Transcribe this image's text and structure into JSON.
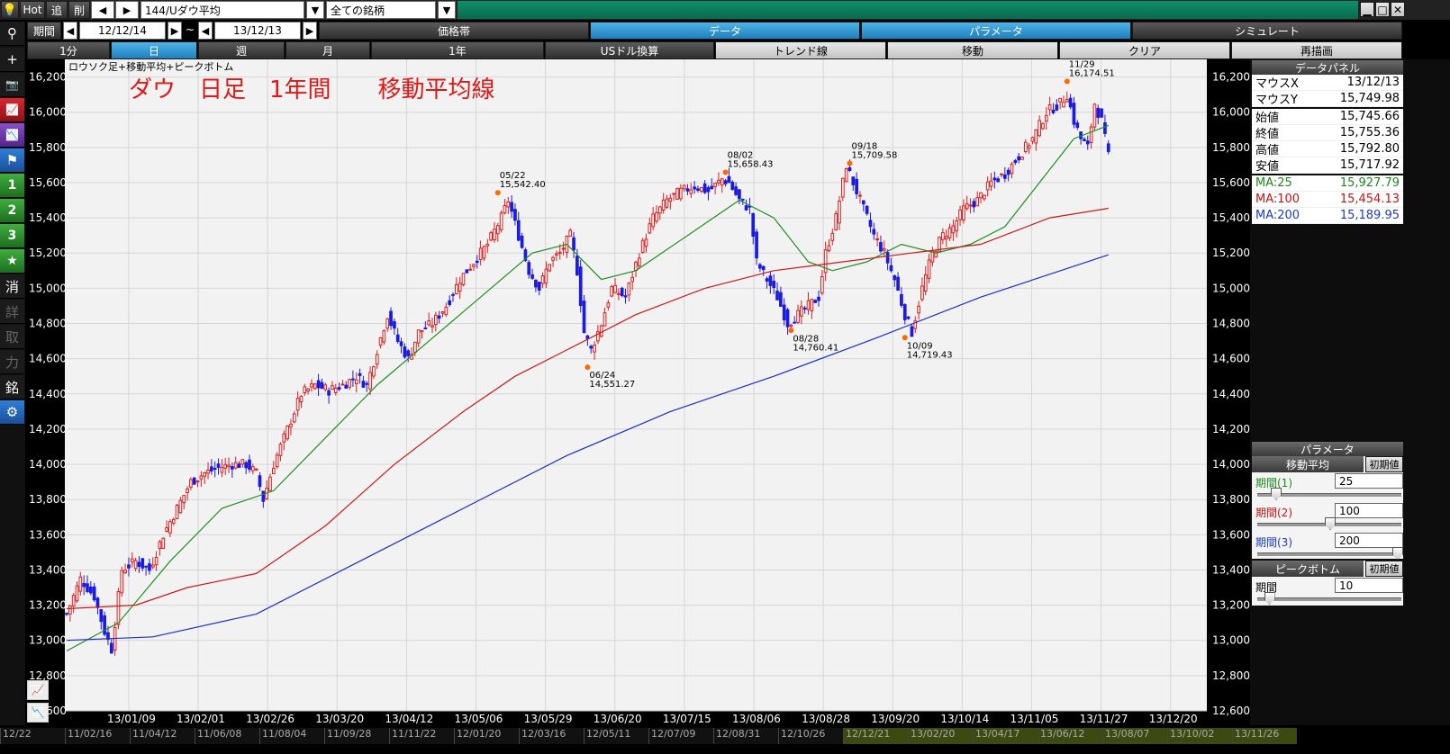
{
  "toolbar": {
    "hot": "Hot",
    "add": "追",
    "del": "削",
    "symbol": "144/Uダウ平均",
    "filter": "全ての銘柄",
    "period_label": "期間",
    "date_from": "12/12/14",
    "tilde": "~",
    "date_to": "13/12/13"
  },
  "menu_tabs": [
    "価格帯",
    "データ",
    "パラメータ",
    "シミュレート"
  ],
  "period_tabs": [
    "1分",
    "日",
    "週",
    "月",
    "1年"
  ],
  "action_tabs": [
    "USドル換算",
    "トレンド線",
    "移動",
    "クリア",
    "再描画"
  ],
  "left_tools": [
    "⚲",
    "+",
    "📷",
    "📈",
    "📉",
    "⚑",
    "1",
    "2",
    "3",
    "★",
    "消",
    "詳",
    "取",
    "力",
    "銘",
    "⚙"
  ],
  "chart_data": {
    "type": "candlestick",
    "title": "ロウソク足+移動平均+ピークボトム",
    "annotation": "ダウ　日足　1年間　　移動平均線",
    "ylim": [
      12600,
      16300
    ],
    "y_ticks": [
      12600,
      12800,
      13000,
      13200,
      13400,
      13600,
      13800,
      14000,
      14200,
      14400,
      14600,
      14800,
      15000,
      15200,
      15400,
      15600,
      15800,
      16000,
      16200
    ],
    "y_tick_labels": [
      "12,600",
      "12,800",
      "13,000",
      "13,200",
      "13,400",
      "13,600",
      "13,800",
      "14,000",
      "14,200",
      "14,400",
      "14,600",
      "14,800",
      "15,000",
      "15,200",
      "15,400",
      "15,600",
      "15,800",
      "16,000",
      "16,200"
    ],
    "x_ticks": [
      "13/01/09",
      "13/02/01",
      "13/02/26",
      "13/03/20",
      "13/04/12",
      "13/05/06",
      "13/05/29",
      "13/06/20",
      "13/07/15",
      "13/08/06",
      "13/08/28",
      "13/09/20",
      "13/10/14",
      "13/11/05",
      "13/11/27",
      "13/12/20"
    ],
    "bottom_timeline": [
      "12/22",
      "11/02/16",
      "11/04/12",
      "11/06/08",
      "11/08/04",
      "11/09/28",
      "11/11/22",
      "12/01/20",
      "12/03/16",
      "12/05/11",
      "12/07/09",
      "12/08/31",
      "12/10/26",
      "12/12/21",
      "13/02/20",
      "13/04/17",
      "13/06/12",
      "13/08/07",
      "13/10/02",
      "13/11/26"
    ],
    "close_path": [
      [
        0,
        13150
      ],
      [
        4,
        13350
      ],
      [
        8,
        13250
      ],
      [
        11,
        13050
      ],
      [
        13,
        12950
      ],
      [
        16,
        13400
      ],
      [
        20,
        13450
      ],
      [
        24,
        13400
      ],
      [
        28,
        13600
      ],
      [
        32,
        13750
      ],
      [
        36,
        13900
      ],
      [
        40,
        13950
      ],
      [
        44,
        13980
      ],
      [
        48,
        14000
      ],
      [
        52,
        14000
      ],
      [
        55,
        13950
      ],
      [
        57,
        13800
      ],
      [
        60,
        14000
      ],
      [
        64,
        14200
      ],
      [
        68,
        14400
      ],
      [
        72,
        14450
      ],
      [
        76,
        14420
      ],
      [
        80,
        14450
      ],
      [
        84,
        14500
      ],
      [
        87,
        14450
      ],
      [
        90,
        14650
      ],
      [
        93,
        14850
      ],
      [
        96,
        14700
      ],
      [
        99,
        14600
      ],
      [
        102,
        14750
      ],
      [
        106,
        14800
      ],
      [
        110,
        14900
      ],
      [
        114,
        15050
      ],
      [
        118,
        15150
      ],
      [
        122,
        15250
      ],
      [
        126,
        15400
      ],
      [
        128,
        15500
      ],
      [
        131,
        15300
      ],
      [
        134,
        15100
      ],
      [
        137,
        15000
      ],
      [
        140,
        15150
      ],
      [
        143,
        15200
      ],
      [
        146,
        15300
      ],
      [
        148,
        15100
      ],
      [
        150,
        14750
      ],
      [
        152,
        14650
      ],
      [
        155,
        14800
      ],
      [
        158,
        15000
      ],
      [
        162,
        14950
      ],
      [
        166,
        15200
      ],
      [
        170,
        15400
      ],
      [
        174,
        15500
      ],
      [
        178,
        15550
      ],
      [
        182,
        15580
      ],
      [
        186,
        15550
      ],
      [
        190,
        15620
      ],
      [
        192,
        15600
      ],
      [
        195,
        15500
      ],
      [
        198,
        15450
      ],
      [
        200,
        15150
      ],
      [
        203,
        15050
      ],
      [
        206,
        14950
      ],
      [
        209,
        14800
      ],
      [
        212,
        14850
      ],
      [
        215,
        14900
      ],
      [
        218,
        14950
      ],
      [
        220,
        15200
      ],
      [
        223,
        15400
      ],
      [
        226,
        15700
      ],
      [
        228,
        15600
      ],
      [
        231,
        15450
      ],
      [
        234,
        15300
      ],
      [
        237,
        15200
      ],
      [
        240,
        15050
      ],
      [
        243,
        14850
      ],
      [
        245,
        14750
      ],
      [
        248,
        15000
      ],
      [
        251,
        15200
      ],
      [
        254,
        15300
      ],
      [
        257,
        15350
      ],
      [
        260,
        15450
      ],
      [
        264,
        15500
      ],
      [
        268,
        15600
      ],
      [
        272,
        15650
      ],
      [
        276,
        15750
      ],
      [
        280,
        15850
      ],
      [
        284,
        16000
      ],
      [
        288,
        16050
      ],
      [
        290,
        16100
      ],
      [
        292,
        15950
      ],
      [
        294,
        15850
      ],
      [
        296,
        15800
      ],
      [
        298,
        16050
      ],
      [
        300,
        15950
      ],
      [
        302,
        15750
      ]
    ],
    "ma_series": [
      {
        "name": "MA:25",
        "color": "#1f8f1f",
        "points": [
          [
            0,
            12940
          ],
          [
            15,
            13100
          ],
          [
            30,
            13450
          ],
          [
            45,
            13750
          ],
          [
            60,
            13850
          ],
          [
            75,
            14150
          ],
          [
            90,
            14450
          ],
          [
            105,
            14700
          ],
          [
            120,
            14950
          ],
          [
            135,
            15200
          ],
          [
            145,
            15250
          ],
          [
            155,
            15050
          ],
          [
            165,
            15100
          ],
          [
            180,
            15300
          ],
          [
            195,
            15500
          ],
          [
            205,
            15400
          ],
          [
            215,
            15150
          ],
          [
            222,
            15100
          ],
          [
            232,
            15150
          ],
          [
            242,
            15250
          ],
          [
            252,
            15200
          ],
          [
            262,
            15250
          ],
          [
            272,
            15350
          ],
          [
            282,
            15600
          ],
          [
            292,
            15850
          ],
          [
            302,
            15925
          ]
        ]
      },
      {
        "name": "MA:100",
        "color": "#cc1a1a",
        "points": [
          [
            0,
            13180
          ],
          [
            20,
            13200
          ],
          [
            35,
            13300
          ],
          [
            55,
            13380
          ],
          [
            75,
            13650
          ],
          [
            95,
            14000
          ],
          [
            115,
            14300
          ],
          [
            130,
            14500
          ],
          [
            145,
            14650
          ],
          [
            165,
            14850
          ],
          [
            185,
            15000
          ],
          [
            205,
            15100
          ],
          [
            225,
            15150
          ],
          [
            245,
            15200
          ],
          [
            265,
            15250
          ],
          [
            285,
            15400
          ],
          [
            302,
            15454
          ]
        ]
      },
      {
        "name": "MA:200",
        "color": "#1a2fcc",
        "points": [
          [
            0,
            13000
          ],
          [
            25,
            13020
          ],
          [
            55,
            13150
          ],
          [
            85,
            13450
          ],
          [
            115,
            13750
          ],
          [
            145,
            14050
          ],
          [
            175,
            14300
          ],
          [
            205,
            14500
          ],
          [
            235,
            14720
          ],
          [
            265,
            14950
          ],
          [
            302,
            15190
          ]
        ]
      }
    ],
    "peaks": [
      {
        "x": 125,
        "y": 15542.4,
        "date": "05/22",
        "value": "15,542.40",
        "pos": "above"
      },
      {
        "x": 151,
        "y": 14551.27,
        "date": "06/24",
        "value": "14,551.27",
        "pos": "below"
      },
      {
        "x": 191,
        "y": 15658.43,
        "date": "08/02",
        "value": "15,658.43",
        "pos": "above"
      },
      {
        "x": 210,
        "y": 14760.41,
        "date": "08/28",
        "value": "14,760.41",
        "pos": "below"
      },
      {
        "x": 227,
        "y": 15709.58,
        "date": "09/18",
        "value": "15,709.58",
        "pos": "above"
      },
      {
        "x": 243,
        "y": 14719.43,
        "date": "10/09",
        "value": "14,719.43",
        "pos": "below"
      },
      {
        "x": 290,
        "y": 16174.51,
        "date": "11/29",
        "value": "16,174.51",
        "pos": "above"
      }
    ]
  },
  "data_panel": {
    "title": "データパネル",
    "rows": [
      {
        "label": "マウスX",
        "value": "13/12/13"
      },
      {
        "label": "マウスY",
        "value": "15,749.98"
      },
      {
        "label": "始値",
        "value": "15,745.66"
      },
      {
        "label": "終値",
        "value": "15,755.36"
      },
      {
        "label": "高値",
        "value": "15,792.80"
      },
      {
        "label": "安値",
        "value": "15,717.92"
      },
      {
        "label": "MA:25",
        "value": "15,927.79",
        "color": "#1a8a1a"
      },
      {
        "label": "MA:100",
        "value": "15,454.13",
        "color": "#cc1111"
      },
      {
        "label": "MA:200",
        "value": "15,189.95",
        "color": "#1a3acc"
      }
    ]
  },
  "params": {
    "title": "パラメータ",
    "ma_label": "移動平均",
    "reset": "初期値",
    "p1_label": "期間(1)",
    "p1_value": "25",
    "p1_level": 0.1,
    "p2_label": "期間(2)",
    "p2_value": "100",
    "p2_level": 0.5,
    "p3_label": "期間(3)",
    "p3_value": "200",
    "p3_level": 1.0,
    "pb_label": "ピークボトム",
    "pb_reset": "初期値",
    "pb_period_label": "期間",
    "pb_value": "10",
    "pb_level": 0.05
  },
  "colors": {
    "accent": "#1e7fbd",
    "candle_up": "#e31b1b",
    "candle_down": "#1a1ae3",
    "chart_bg": "#f2f2f2"
  }
}
